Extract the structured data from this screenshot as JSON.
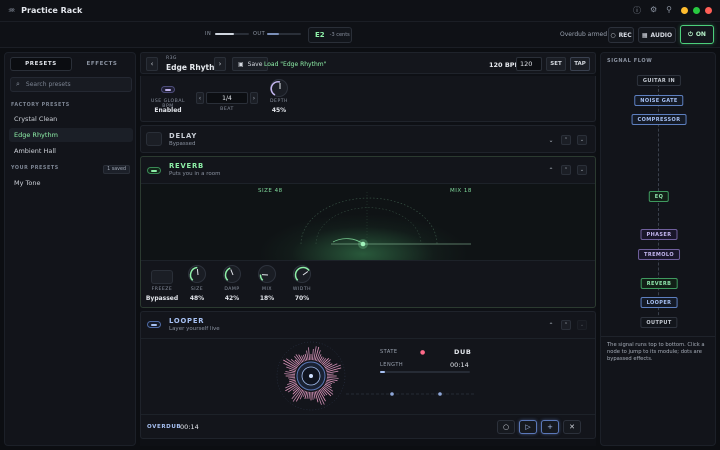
{
  "app": {
    "title": "Practice Rack",
    "icon": "waveform-icon"
  },
  "header": {
    "in_label": "IN",
    "out_label": "OUT",
    "in_level": 0.55,
    "out_level": 0.35,
    "tuner_note": "E2",
    "tuner_cents": "-3 cents",
    "overdub_status": "Overdub armed",
    "rec_label": "REC",
    "audio_label": "AUDIO",
    "on_label": "ON"
  },
  "sidebar": {
    "tabs": [
      "PRESETS",
      "EFFECTS"
    ],
    "search_placeholder": "Search presets",
    "factory_title": "FACTORY PRESETS",
    "factory_presets": [
      "Crystal Clean",
      "Edge Rhythm",
      "Ambient Hall"
    ],
    "your_title": "YOUR PRESETS",
    "saved_badge": "1 saved",
    "your_presets": [
      "My Tone"
    ]
  },
  "preset_bar": {
    "tag": "R3G",
    "name": "Edge Rhythm",
    "save_label": "Save",
    "load_link": "Load \"Edge Rhythm\"",
    "bpm_label": "120 BPM",
    "bpm_value": "120",
    "set_label": "SET",
    "tap_label": "TAP"
  },
  "tempo_section": {
    "global_bpm_label": "USE GLOBAL BPM",
    "global_bpm_value": "Enabled",
    "beat_value": "1/4",
    "beat_label": "BEAT",
    "depth_label": "DEPTH",
    "depth_value": "45%"
  },
  "delay": {
    "title": "DELAY",
    "subtitle": "Bypassed"
  },
  "reverb": {
    "title": "REVERB",
    "subtitle": "Puts you in a room",
    "viz_size": "SIZE 48",
    "viz_mix": "MIX 18",
    "freeze_label": "FREEZE",
    "freeze_value": "Bypassed",
    "knobs": [
      {
        "label": "SIZE",
        "value": "48%",
        "level": 0.48
      },
      {
        "label": "DAMP",
        "value": "42%",
        "level": 0.42
      },
      {
        "label": "MIX",
        "value": "18%",
        "level": 0.18
      },
      {
        "label": "WIDTH",
        "value": "70%",
        "level": 0.7
      }
    ]
  },
  "looper": {
    "title": "LOOPER",
    "subtitle": "Layer yourself live",
    "state_label": "STATE",
    "state_value": "DUB",
    "length_label": "LENGTH",
    "length_value": "00:14",
    "length_progress": 0.05,
    "footer_mode": "OVERDUB",
    "footer_time": "00:14"
  },
  "signal_flow": {
    "title": "SIGNAL FLOW",
    "nodes": [
      "GUITAR IN",
      "NOISE GATE",
      "COMPRESSOR",
      "EQ",
      "PHASER",
      "TREMOLO",
      "REVERB",
      "LOOPER",
      "OUTPUT"
    ],
    "note": "The signal runs top to bottom. Click a node to jump to its module; dots are bypassed effects."
  },
  "colors": {
    "accent_green": "#8ef0a8",
    "accent_blue": "#a7c1f3",
    "accent_purple": "#c4b6ef",
    "close": "#ff5f57",
    "minimize": "#febc2e",
    "maximize": "#28c840"
  }
}
